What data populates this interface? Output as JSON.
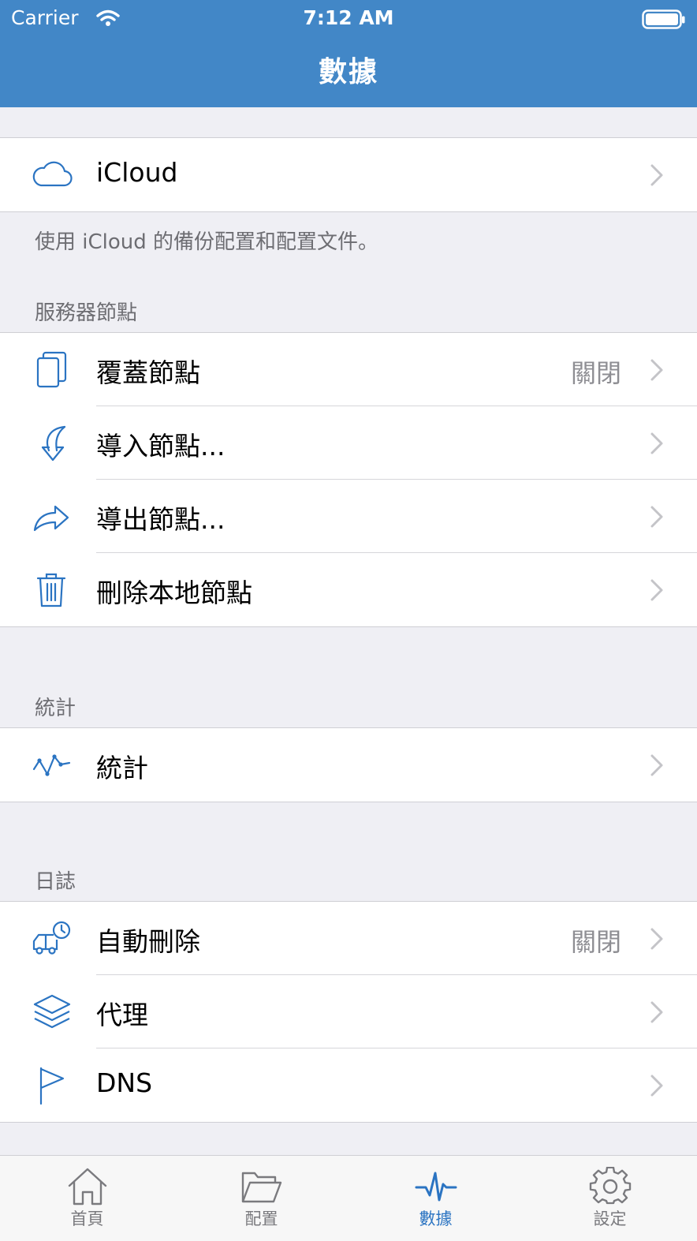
{
  "status_bar": {
    "carrier": "Carrier",
    "time": "7:12 AM"
  },
  "nav": {
    "title": "數據"
  },
  "colors": {
    "accent": "#2b74c2",
    "nav_bg": "#4287c7"
  },
  "icloud_group": {
    "row": {
      "label": "iCloud",
      "icon": "cloud-icon"
    },
    "footer": "使用 iCloud 的備份配置和配置文件。"
  },
  "server_nodes": {
    "title": "服務器節點",
    "rows": [
      {
        "label": "覆蓋節點",
        "value": "關閉",
        "icon": "copy-icon"
      },
      {
        "label": "導入節點...",
        "icon": "import-icon"
      },
      {
        "label": "導出節點...",
        "icon": "share-icon"
      },
      {
        "label": "刪除本地節點",
        "icon": "trash-icon"
      }
    ]
  },
  "stats": {
    "title": "統計",
    "rows": [
      {
        "label": "統計",
        "icon": "activity-icon"
      }
    ]
  },
  "logs": {
    "title": "日誌",
    "rows": [
      {
        "label": "自動刪除",
        "value": "關閉",
        "icon": "truck-clock-icon"
      },
      {
        "label": "代理",
        "icon": "layers-icon"
      },
      {
        "label": "DNS",
        "icon": "flag-icon"
      }
    ]
  },
  "tabbar": {
    "tabs": [
      {
        "label": "首頁",
        "icon": "home-icon"
      },
      {
        "label": "配置",
        "icon": "folder-icon"
      },
      {
        "label": "數據",
        "icon": "pulse-icon",
        "active": true
      },
      {
        "label": "設定",
        "icon": "gear-icon"
      }
    ]
  }
}
